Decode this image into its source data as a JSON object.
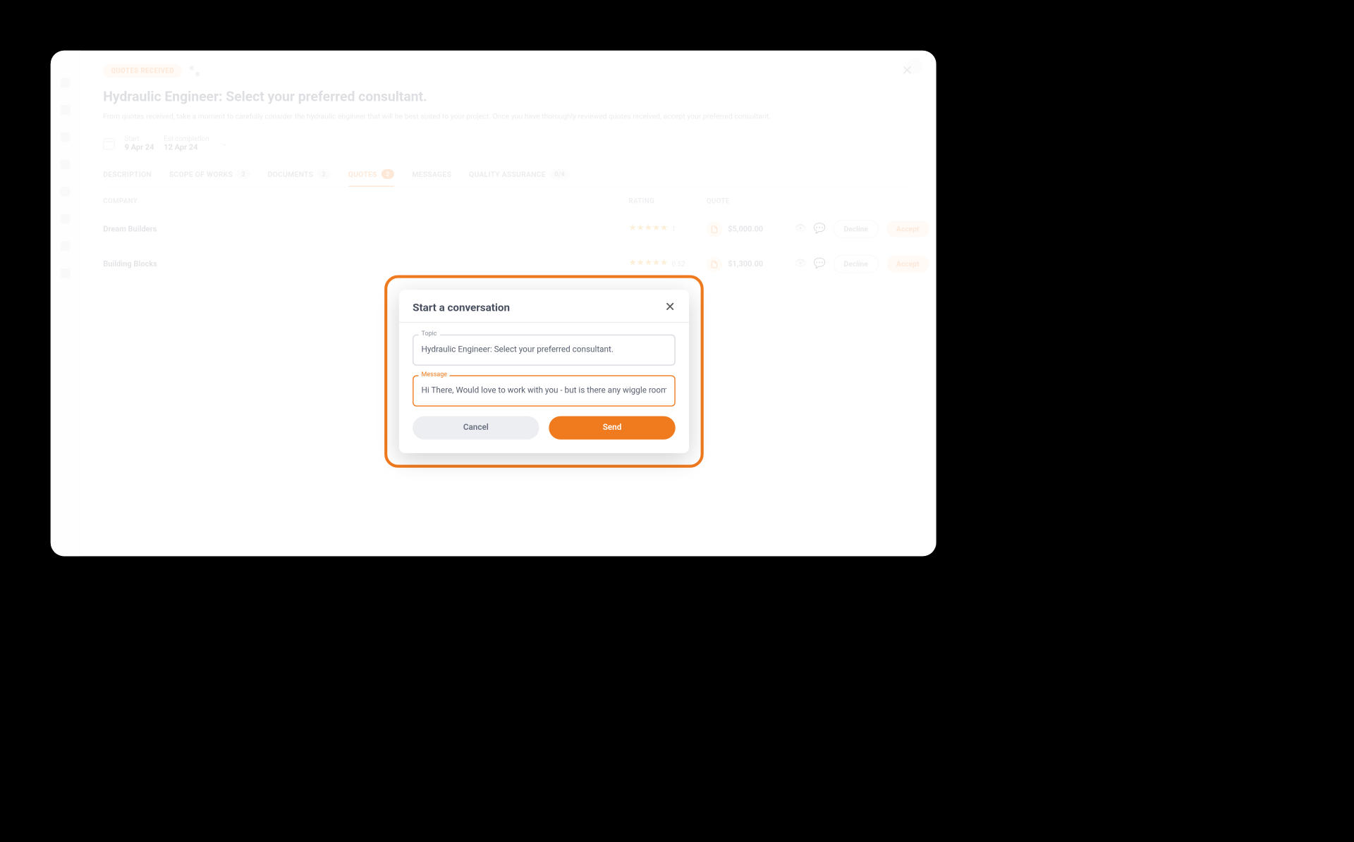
{
  "status_badge": "QUOTES RECEIVED",
  "avatar": {},
  "page_title": "Hydraulic Engineer: Select your preferred consultant.",
  "page_sub": "From quotes received, take a moment to carefully consider the hydraulic engineer that will be best suited to your project. Once you have thoroughly reviewed quotes received, accept your preferred consultant.",
  "dates": {
    "start_label": "Start",
    "start_value": "9 Apr 24",
    "end_label": "Est completion",
    "end_value": "12 Apr 24"
  },
  "tabs": {
    "description": "DESCRIPTION",
    "scope": "SCOPE OF WORKS",
    "scope_badge": "2",
    "documents": "DOCUMENTS",
    "documents_badge": "2",
    "quotes": "QUOTES",
    "quotes_badge": "2",
    "messages": "MESSAGES",
    "qa": "QUALITY ASSURANCE",
    "qa_badge": "0/4"
  },
  "thead": {
    "company": "COMPANY",
    "rating": "RATING",
    "quote": "QUOTE"
  },
  "rows": [
    {
      "company": "Dream Builders",
      "stars": "★★★★★",
      "rtext": "1",
      "price": "$5,000.00",
      "decline": "Decline",
      "accept": "Accept"
    },
    {
      "company": "Building Blocks",
      "stars": "★★★★★",
      "rtext": "0.52",
      "price": "$1,300.00",
      "decline": "Decline",
      "accept": "Accept"
    }
  ],
  "modal": {
    "title": "Start a conversation",
    "topic_label": "Topic",
    "topic_value": "Hydraulic Engineer: Select your preferred consultant.",
    "message_label": "Message",
    "message_value": "Hi There, Would love to work with you - but is there any wiggle room on the price?",
    "cancel": "Cancel",
    "send": "Send"
  }
}
